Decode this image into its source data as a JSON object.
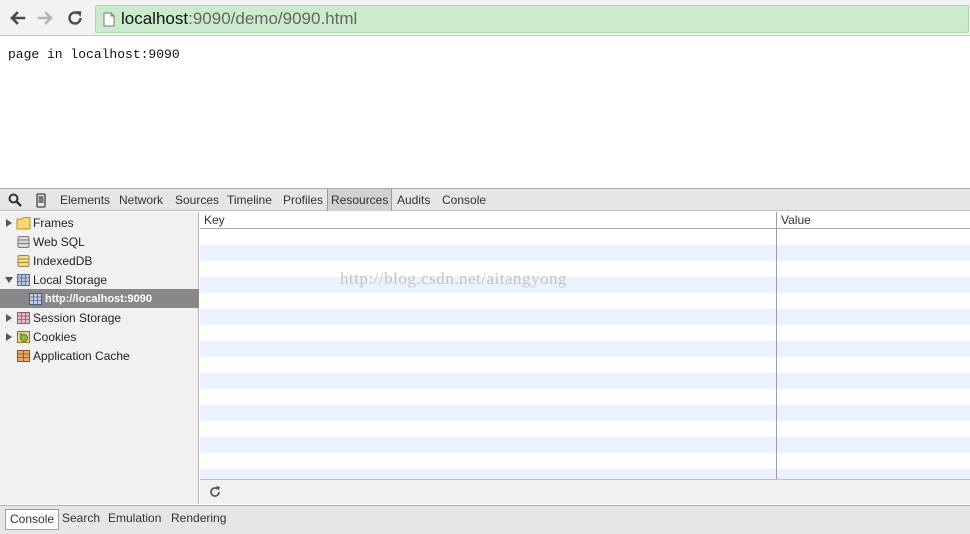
{
  "browser": {
    "url_host": "localhost",
    "url_rest": ":9090/demo/9090.html",
    "back_icon": "back-arrow-icon",
    "forward_icon": "forward-arrow-icon",
    "reload_icon": "reload-icon",
    "omnibox_color": "#ccebcc"
  },
  "page": {
    "text": "page in localhost:9090"
  },
  "devtools": {
    "tabs": [
      "Elements",
      "Network",
      "Sources",
      "Timeline",
      "Profiles",
      "Resources",
      "Audits",
      "Console"
    ],
    "active_tab": "Resources",
    "sidebar": {
      "items": [
        {
          "label": "Frames",
          "icon": "folder-icon"
        },
        {
          "label": "Web SQL",
          "icon": "database-icon"
        },
        {
          "label": "IndexedDB",
          "icon": "database-icon"
        },
        {
          "label": "Local Storage",
          "icon": "storage-grid-icon"
        },
        {
          "label": "http://localhost:9090",
          "icon": "storage-grid-icon"
        },
        {
          "label": "Session Storage",
          "icon": "storage-grid-icon"
        },
        {
          "label": "Cookies",
          "icon": "cookie-icon"
        },
        {
          "label": "Application Cache",
          "icon": "app-cache-icon"
        }
      ],
      "selected": "http://localhost:9090"
    },
    "grid": {
      "columns": [
        "Key",
        "Value"
      ],
      "watermark": "http://blog.csdn.net/aitangyong",
      "stripe_color": "#e9f2fd"
    },
    "drawer_tabs": [
      "Console",
      "Search",
      "Emulation",
      "Rendering"
    ],
    "active_drawer_tab": "Console"
  }
}
